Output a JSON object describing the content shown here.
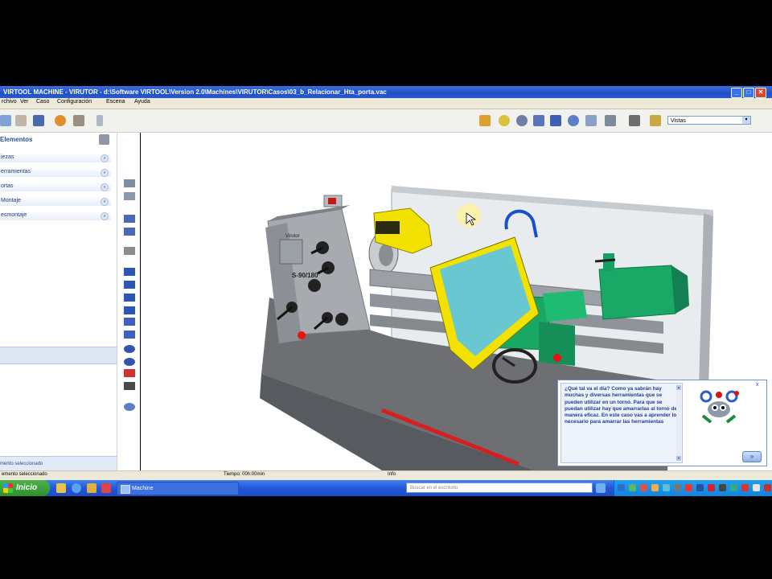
{
  "window": {
    "title": "VIRTOOL MACHINE - VIRUTOR - d:\\Software VIRTOOL\\Version 2.0\\Machines\\VIRUTOR\\Casos\\03_b_Relacionar_Hta_porta.vac",
    "buttons": {
      "minimize": "_",
      "maximize": "□",
      "close": "✕"
    }
  },
  "menu": [
    "rchivo",
    "Ver",
    "Caso",
    "Configuración",
    "Escena",
    "Ayuda"
  ],
  "toolbar": {
    "view_select": "Vistas",
    "view_arrow": "▾"
  },
  "left_panel": {
    "header": "Elementos",
    "items": [
      {
        "label": "iezas",
        "arrow": "»"
      },
      {
        "label": "erramientas",
        "arrow": "»"
      },
      {
        "label": "ortas",
        "arrow": "»"
      },
      {
        "label": "Montaje",
        "arrow": "»"
      },
      {
        "label": "esmontaje",
        "arrow": "»"
      }
    ],
    "footer": "mento seleccionado"
  },
  "status": {
    "left": "emento seleccionado",
    "time": "Tiempo: 00h:00min",
    "info": "Info"
  },
  "help_box": {
    "text": "¿Qué tal va el día? Como ya sabrán hay muchas y diversas herramientas que se pueden utilizar en un torno. Para que se puedan utilizar hay que amarrarlas al torno de manera eficaz. En este caso vas a aprender lo necesario para amarrar las herramientas",
    "next_label": "»",
    "scroll_up": "▲",
    "scroll_down": "▼"
  },
  "machine": {
    "plate_label": "S-90/180",
    "brand_label": "Virutor"
  },
  "taskbar": {
    "start_label": "Inicio",
    "task_item": "Machine",
    "search_placeholder": "Buscar en el escritorio"
  },
  "colors": {
    "titlebar": "#1f4fc4",
    "accent_yellow": "#f3e200",
    "machine_green": "#1fae6c",
    "machine_grey": "#8a8f94"
  }
}
